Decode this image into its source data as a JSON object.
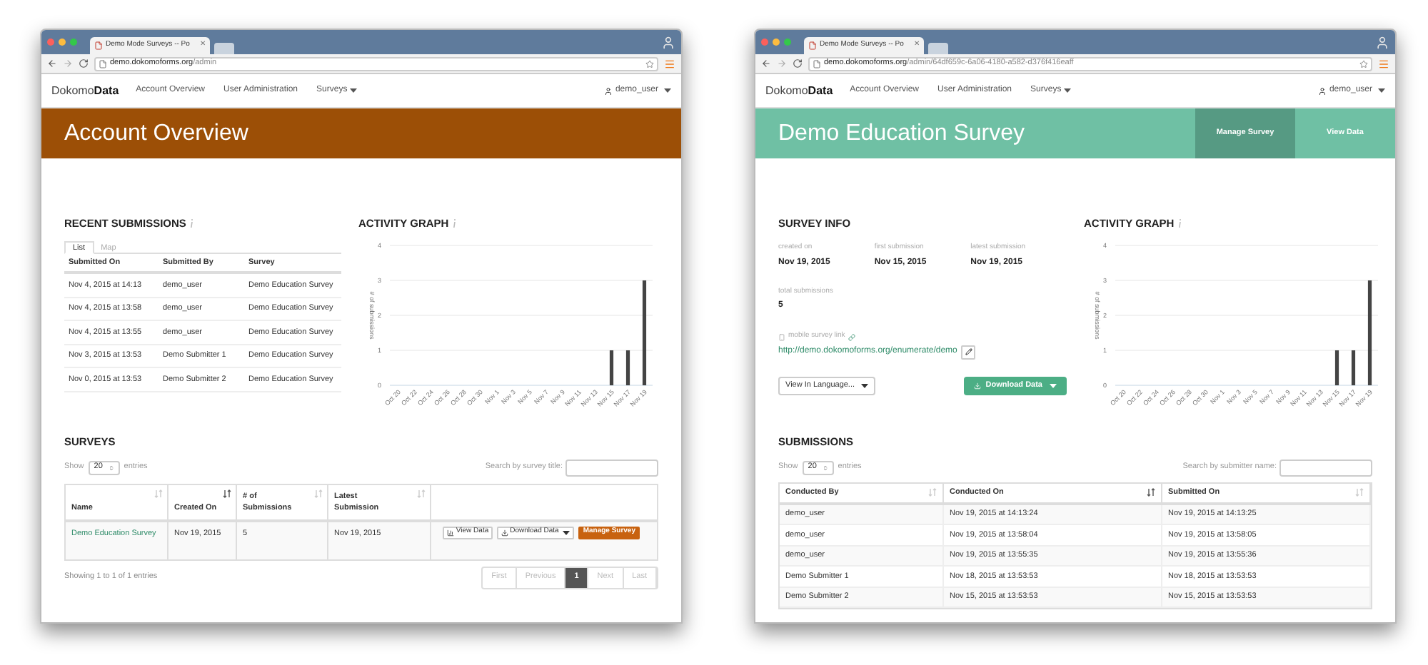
{
  "windows": [
    {
      "kind": "account",
      "tab_title": "Demo Mode Surveys -- Po",
      "tab_close": "✕",
      "url_host": "demo.dokomoforms.org",
      "url_path": "/admin",
      "nav": {
        "brand_light": "Dokomo",
        "brand_bold": "Data",
        "items": [
          {
            "label": "Account Overview",
            "dropdown": false
          },
          {
            "label": "User Administration",
            "dropdown": false
          },
          {
            "label": "Surveys",
            "dropdown": true
          }
        ],
        "user": "demo_user"
      },
      "banner": {
        "title": "Account Overview",
        "color": "#9c4f06"
      },
      "recent_submissions": {
        "title": "RECENT SUBMISSIONS",
        "tabs": [
          {
            "label": "List",
            "selected": true
          },
          {
            "label": "Map",
            "selected": false
          }
        ],
        "columns": [
          "Submitted On",
          "Submitted By",
          "Survey"
        ],
        "rows": [
          [
            "Nov 4, 2015 at 14:13",
            "demo_user",
            "Demo Education Survey"
          ],
          [
            "Nov 4, 2015 at 13:58",
            "demo_user",
            "Demo Education Survey"
          ],
          [
            "Nov 4, 2015 at 13:55",
            "demo_user",
            "Demo Education Survey"
          ],
          [
            "Nov 3, 2015 at 13:53",
            "Demo Submitter 1",
            "Demo Education Survey"
          ],
          [
            "Nov 0, 2015 at 13:53",
            "Demo Submitter 2",
            "Demo Education Survey"
          ]
        ]
      },
      "activity_graph": {
        "title": "ACTIVITY GRAPH",
        "chart_data": {
          "type": "bar",
          "grid": true,
          "ylabel": "# of submissions",
          "categories": [
            "Oct 20",
            "Oct 22",
            "Oct 24",
            "Oct 26",
            "Oct 28",
            "Oct 30",
            "Nov 1",
            "Nov 3",
            "Nov 5",
            "Nov 7",
            "Nov 9",
            "Nov 11",
            "Nov 13",
            "Nov 15",
            "Nov 17",
            "Nov 19"
          ],
          "values": [
            0,
            0,
            0,
            0,
            0,
            0,
            0,
            0,
            0,
            0,
            0,
            0,
            0,
            1,
            1,
            3
          ],
          "ylim": [
            0,
            4
          ],
          "yticks": [
            0,
            1,
            2,
            3,
            4
          ]
        }
      },
      "surveys": {
        "title": "SURVEYS",
        "show_label": "Show",
        "page_size": "20",
        "entries_label": "entries",
        "search_label": "Search by survey title:",
        "columns": [
          {
            "label": "Name",
            "sorted": false
          },
          {
            "label": "Created On",
            "sorted": true
          },
          {
            "label": "# of Submissions",
            "sorted": false
          },
          {
            "label": "Latest Submission",
            "sorted": false
          }
        ],
        "rows": [
          {
            "name": "Demo Education Survey",
            "created_on": "Nov 19, 2015",
            "submissions": "5",
            "latest": "Nov 19, 2015",
            "actions": [
              {
                "kind": "view",
                "label": "View Data"
              },
              {
                "kind": "download",
                "label": "Download Data"
              },
              {
                "kind": "manage",
                "label": "Manage Survey"
              }
            ]
          }
        ],
        "summary": "Showing 1 to 1 of 1 entries",
        "pages": [
          {
            "label": "First",
            "selected": false
          },
          {
            "label": "Previous",
            "selected": false
          },
          {
            "label": "1",
            "selected": true
          },
          {
            "label": "Next",
            "selected": false
          },
          {
            "label": "Last",
            "selected": false
          }
        ]
      }
    },
    {
      "kind": "survey",
      "tab_title": "Demo Mode Surveys -- Po",
      "tab_close": "✕",
      "url_host": "demo.dokomoforms.org",
      "url_path": "/admin/64df659c-6a06-4180-a582-d376f416eaff",
      "nav": {
        "brand_light": "Dokomo",
        "brand_bold": "Data",
        "items": [
          {
            "label": "Account Overview",
            "dropdown": false
          },
          {
            "label": "User Administration",
            "dropdown": false
          },
          {
            "label": "Surveys",
            "dropdown": true
          }
        ],
        "user": "demo_user"
      },
      "banner": {
        "title": "Demo Education Survey",
        "color": "#6fc0a4",
        "buttons": [
          {
            "label": "Manage Survey",
            "selected": true
          },
          {
            "label": "View Data",
            "selected": false
          }
        ]
      },
      "survey_info": {
        "title": "SURVEY INFO",
        "stats": [
          {
            "label": "created on",
            "value": "Nov 19, 2015"
          },
          {
            "label": "first submission",
            "value": "Nov 15, 2015"
          },
          {
            "label": "latest submission",
            "value": "Nov 19, 2015"
          },
          {
            "label": "total submissions",
            "value": "5"
          }
        ],
        "link_label": "mobile survey link",
        "link": "http://demo.dokomoforms.org/enumerate/demo",
        "language_button": "View In Language...",
        "download_button": "Download Data"
      },
      "activity_graph": {
        "title": "ACTIVITY GRAPH",
        "chart_data": {
          "type": "bar",
          "grid": true,
          "ylabel": "# of submissions",
          "categories": [
            "Oct 20",
            "Oct 22",
            "Oct 24",
            "Oct 26",
            "Oct 28",
            "Oct 30",
            "Nov 1",
            "Nov 3",
            "Nov 5",
            "Nov 7",
            "Nov 9",
            "Nov 11",
            "Nov 13",
            "Nov 15",
            "Nov 17",
            "Nov 19"
          ],
          "values": [
            0,
            0,
            0,
            0,
            0,
            0,
            0,
            0,
            0,
            0,
            0,
            0,
            0,
            1,
            1,
            3
          ],
          "ylim": [
            0,
            4
          ],
          "yticks": [
            0,
            1,
            2,
            3,
            4
          ]
        }
      },
      "submissions": {
        "title": "SUBMISSIONS",
        "show_label": "Show",
        "page_size": "20",
        "entries_label": "entries",
        "search_label": "Search by submitter name:",
        "columns": [
          {
            "label": "Conducted By",
            "sorted": false
          },
          {
            "label": "Conducted On",
            "sorted": true
          },
          {
            "label": "Submitted On",
            "sorted": false
          }
        ],
        "rows": [
          [
            "demo_user",
            "Nov 19, 2015 at 14:13:24",
            "Nov 19, 2015 at 14:13:25"
          ],
          [
            "demo_user",
            "Nov 19, 2015 at 13:58:04",
            "Nov 19, 2015 at 13:58:05"
          ],
          [
            "demo_user",
            "Nov 19, 2015 at 13:55:35",
            "Nov 19, 2015 at 13:55:36"
          ],
          [
            "Demo Submitter 1",
            "Nov 18, 2015 at 13:53:53",
            "Nov 18, 2015 at 13:53:53"
          ],
          [
            "Demo Submitter 2",
            "Nov 15, 2015 at 13:53:53",
            "Nov 15, 2015 at 13:53:53"
          ]
        ]
      }
    }
  ]
}
